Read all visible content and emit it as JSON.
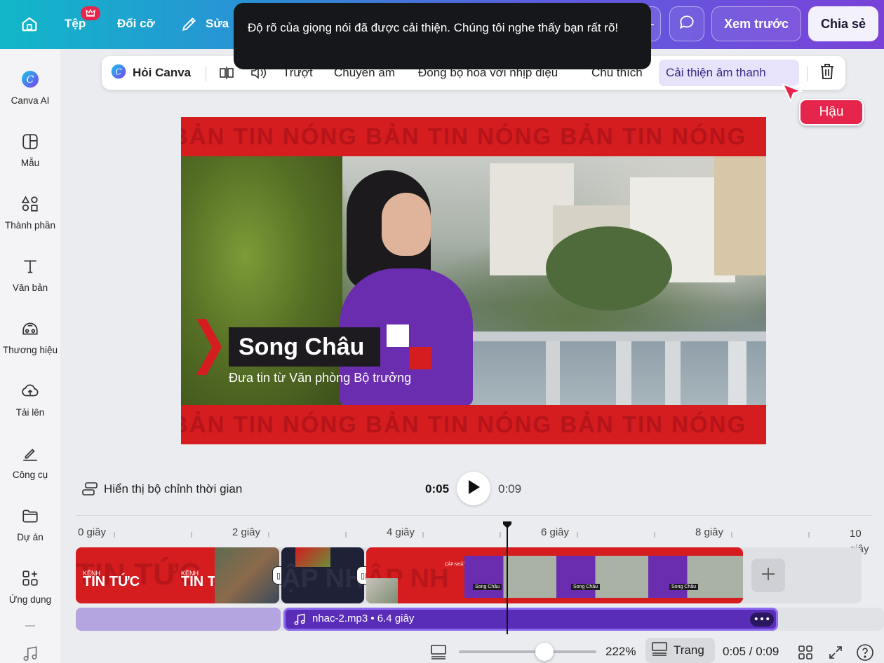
{
  "topbar": {
    "file_label": "Tệp",
    "resize_label": "Đổi cỡ",
    "edit_label": "Sửa",
    "preview_label": "Xem trước",
    "share_label": "Chia sẻ"
  },
  "toast": {
    "message": "Độ rõ của giọng nói đã được cải thiện. Chúng tôi nghe thấy bạn rất rõ!"
  },
  "context_bar": {
    "ask_canva": "Hỏi Canva",
    "slide": "Trượt",
    "transition": "Chuyển âm",
    "beat_sync": "Đồng bộ hóa với nhịp điệu",
    "caption": "Chú thích",
    "enhance_audio": "Cải thiện âm thanh"
  },
  "collaborator": {
    "name": "Hậu"
  },
  "sidebar": {
    "items": [
      {
        "label": "Canva AI",
        "icon": "canva-ai-icon"
      },
      {
        "label": "Mẫu",
        "icon": "template-icon"
      },
      {
        "label": "Thành phần",
        "icon": "elements-icon"
      },
      {
        "label": "Văn bản",
        "icon": "text-icon"
      },
      {
        "label": "Thương hiệu",
        "icon": "brand-icon"
      },
      {
        "label": "Tải lên",
        "icon": "upload-icon"
      },
      {
        "label": "Công cụ",
        "icon": "tools-icon"
      },
      {
        "label": "Dự án",
        "icon": "folder-icon"
      },
      {
        "label": "Ứng dụng",
        "icon": "apps-icon"
      }
    ]
  },
  "canvas": {
    "band_text": "BẢN TIN NÓNG BẢN TIN NÓNG BẢN TIN NÓNG",
    "name": "Song Châu",
    "subtitle": "Đưa tin từ Văn phòng Bộ trưởng"
  },
  "timeline": {
    "show_editor_label": "Hiển thị bộ chỉnh thời gian",
    "current_time": "0:05",
    "total_time": "0:09",
    "ruler": [
      "0 giây",
      "2 giây",
      "4 giây",
      "6 giây",
      "8 giây",
      "10 giây"
    ],
    "clip1_text": "TIN TỨC",
    "clip1_small": "KÊNH",
    "clip2_text": "TIN TỨC",
    "clip2_small": "KÊNH",
    "clip3_text": "CẬP NHẬT",
    "clip4_text": "CẬP NHẬT",
    "thumb_name": "Song Châu",
    "audio_label": "nhac-2.mp3 • 6.4 giây"
  },
  "footer": {
    "zoom": "222%",
    "zoom_level": 0.62,
    "page_label": "Trang",
    "time_readout": "0:05 / 0:09"
  },
  "colors": {
    "accent_red": "#d51c1f",
    "audio_purple": "#5a2db8",
    "toast_bg": "#15171b"
  }
}
